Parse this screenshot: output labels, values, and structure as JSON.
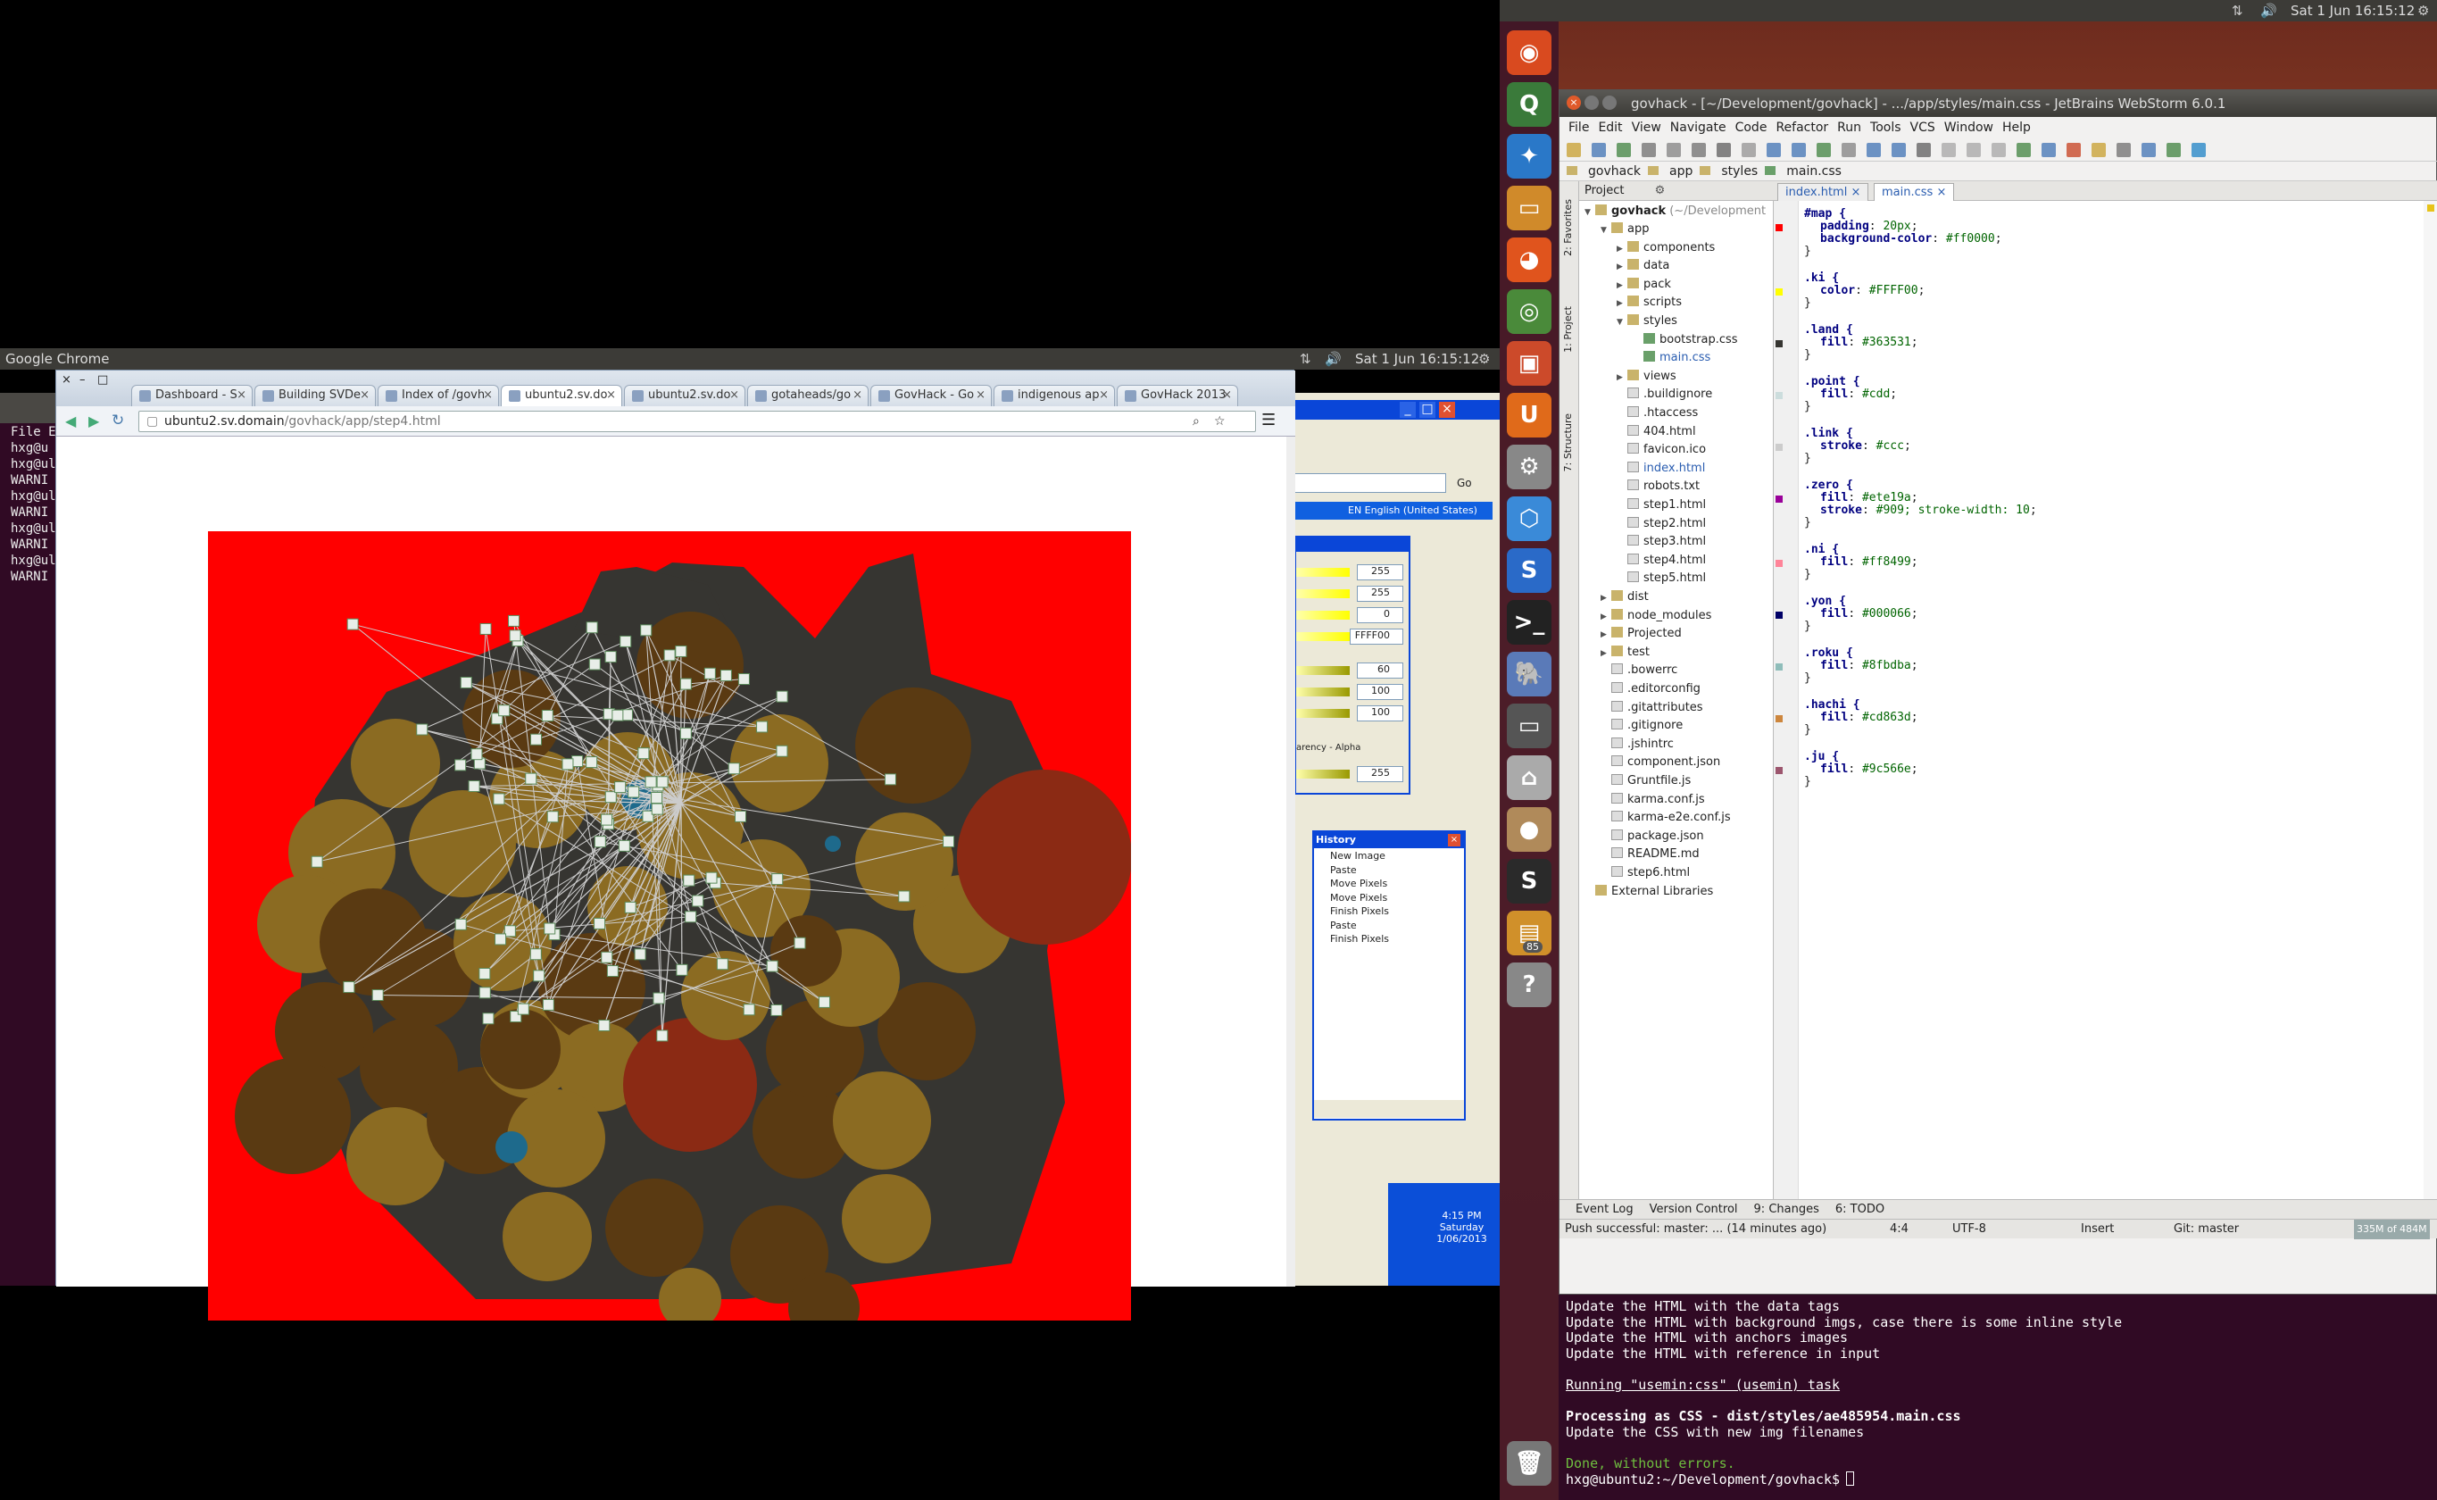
{
  "left_panel": {
    "app_name": "Google Chrome",
    "clock": "Sat  1 Jun  16:15:12",
    "terminal_lines": [
      "File  Ed",
      "hxg@u",
      "hxg@ul",
      "WARNI",
      "hxg@ul",
      "WARNI",
      "hxg@ul",
      "WARNI",
      "hxg@ul",
      "WARNI"
    ]
  },
  "chrome": {
    "tabs": [
      "Dashboard - S",
      "Building SVDe",
      "Index of /govh",
      "ubuntu2.sv.do",
      "ubuntu2.sv.do",
      "gotaheads/go",
      "GovHack - Go",
      "indigenous ap",
      "GovHack 2013"
    ],
    "active_tab": 3,
    "url_host": "ubuntu2.sv.domain",
    "url_path": "/govhack/app/step4.html"
  },
  "xp": {
    "go_label": "Go",
    "lang_label": "EN English (United States)",
    "color_values": [
      "255",
      "255",
      "0",
      "FFFF00",
      "60",
      "100",
      "100",
      "255"
    ],
    "transparency_label": "arency - Alpha",
    "history_title": "History",
    "history_items": [
      "New Image",
      "Paste",
      "Move Pixels",
      "Move Pixels",
      "Finish Pixels",
      "Paste",
      "Finish Pixels"
    ],
    "taskbar_time": "4:15 PM",
    "taskbar_day": "Saturday",
    "taskbar_date": "1/06/2013"
  },
  "right_panel": {
    "clock": "Sat  1 Jun  16:15:12",
    "ws_title": "govhack - [~/Development/govhack] - .../app/styles/main.css - JetBrains WebStorm 6.0.1",
    "menu": [
      "File",
      "Edit",
      "View",
      "Navigate",
      "Code",
      "Refactor",
      "Run",
      "Tools",
      "VCS",
      "Window",
      "Help"
    ],
    "breadcrumb": [
      "govhack",
      "app",
      "styles",
      "main.css"
    ],
    "project_label": "Project",
    "project_root": "govhack",
    "project_root_path": "(~/Development",
    "editor_tabs": [
      "index.html",
      "main.css"
    ],
    "side_labels": [
      "2: Favorites",
      "1: Project",
      "7: Structure"
    ],
    "bottom_tabs": [
      "Event Log",
      "Version Control",
      "9: Changes",
      "6: TODO"
    ],
    "status": {
      "message": "Push successful: master: ... (14 minutes ago)",
      "position": "4:4",
      "encoding": "UTF-8",
      "insert": "Insert",
      "git": "Git: master",
      "memory": "335M of 484M"
    },
    "launcher_badge": "85"
  },
  "tree": [
    {
      "d": 1,
      "t": "folder",
      "n": "app",
      "open": true
    },
    {
      "d": 2,
      "t": "folder",
      "n": "components"
    },
    {
      "d": 2,
      "t": "folder",
      "n": "data"
    },
    {
      "d": 2,
      "t": "folder",
      "n": "pack"
    },
    {
      "d": 2,
      "t": "folder",
      "n": "scripts"
    },
    {
      "d": 2,
      "t": "folder",
      "n": "styles",
      "open": true
    },
    {
      "d": 3,
      "t": "css",
      "n": "bootstrap.css"
    },
    {
      "d": 3,
      "t": "css",
      "n": "main.css",
      "sel": true
    },
    {
      "d": 2,
      "t": "folder",
      "n": "views"
    },
    {
      "d": 2,
      "t": "file",
      "n": ".buildignore"
    },
    {
      "d": 2,
      "t": "file",
      "n": ".htaccess"
    },
    {
      "d": 2,
      "t": "file",
      "n": "404.html"
    },
    {
      "d": 2,
      "t": "file",
      "n": "favicon.ico"
    },
    {
      "d": 2,
      "t": "file",
      "n": "index.html",
      "blue": true
    },
    {
      "d": 2,
      "t": "file",
      "n": "robots.txt"
    },
    {
      "d": 2,
      "t": "file",
      "n": "step1.html"
    },
    {
      "d": 2,
      "t": "file",
      "n": "step2.html"
    },
    {
      "d": 2,
      "t": "file",
      "n": "step3.html"
    },
    {
      "d": 2,
      "t": "file",
      "n": "step4.html"
    },
    {
      "d": 2,
      "t": "file",
      "n": "step5.html"
    },
    {
      "d": 1,
      "t": "folder",
      "n": "dist"
    },
    {
      "d": 1,
      "t": "folder",
      "n": "node_modules"
    },
    {
      "d": 1,
      "t": "folder",
      "n": "Projected"
    },
    {
      "d": 1,
      "t": "folder",
      "n": "test"
    },
    {
      "d": 1,
      "t": "file",
      "n": ".bowerrc"
    },
    {
      "d": 1,
      "t": "file",
      "n": ".editorconfig"
    },
    {
      "d": 1,
      "t": "file",
      "n": ".gitattributes"
    },
    {
      "d": 1,
      "t": "file",
      "n": ".gitignore"
    },
    {
      "d": 1,
      "t": "file",
      "n": ".jshintrc"
    },
    {
      "d": 1,
      "t": "file",
      "n": "component.json"
    },
    {
      "d": 1,
      "t": "file",
      "n": "Gruntfile.js"
    },
    {
      "d": 1,
      "t": "file",
      "n": "karma.conf.js"
    },
    {
      "d": 1,
      "t": "file",
      "n": "karma-e2e.conf.js"
    },
    {
      "d": 1,
      "t": "file",
      "n": "package.json"
    },
    {
      "d": 1,
      "t": "file",
      "n": "README.md"
    },
    {
      "d": 1,
      "t": "file",
      "n": "step6.html"
    },
    {
      "d": 0,
      "t": "lib",
      "n": "External Libraries"
    }
  ],
  "code": [
    {
      "sel": "#map {",
      "props": [
        [
          "padding",
          "20px"
        ],
        [
          "background-color",
          "#ff0000"
        ]
      ],
      "mark": "#ff0000"
    },
    {
      "sel": ".ki {",
      "props": [
        [
          "color",
          "#FFFF00"
        ]
      ],
      "mark": "#FFFF00"
    },
    {
      "sel": ".land {",
      "props": [
        [
          "fill",
          "#363531"
        ]
      ],
      "mark": "#363531"
    },
    {
      "sel": ".point {",
      "props": [
        [
          "fill",
          "#cdd"
        ]
      ],
      "mark": "#ccdddd"
    },
    {
      "sel": ".link {",
      "props": [
        [
          "stroke",
          "#ccc"
        ]
      ],
      "mark": "#cccccc"
    },
    {
      "sel": ".zero {",
      "props": [
        [
          "fill",
          "#ete19a"
        ],
        [
          "stroke",
          "#909; stroke-width: 10"
        ]
      ],
      "mark": "#990099"
    },
    {
      "sel": ".ni {",
      "props": [
        [
          "fill",
          "#ff8499"
        ]
      ],
      "mark": "#ff8499"
    },
    {
      "sel": ".yon {",
      "props": [
        [
          "fill",
          "#000066"
        ]
      ],
      "mark": "#000066"
    },
    {
      "sel": ".roku {",
      "props": [
        [
          "fill",
          "#8fbdba"
        ]
      ],
      "mark": "#8fbdba"
    },
    {
      "sel": ".hachi {",
      "props": [
        [
          "fill",
          "#cd863d"
        ]
      ],
      "mark": "#cd863d"
    },
    {
      "sel": ".ju {",
      "props": [
        [
          "fill",
          "#9c566e"
        ]
      ],
      "mark": "#9c566e"
    }
  ],
  "terminal": [
    {
      "t": "Update the HTML with the data tags"
    },
    {
      "t": "Update the HTML with background imgs, case there is some inline style"
    },
    {
      "t": "Update the HTML with anchors images"
    },
    {
      "t": "Update the HTML with reference in input"
    },
    {
      "t": ""
    },
    {
      "t": "Running \"usemin:css\" (usemin) task",
      "u": true
    },
    {
      "t": ""
    },
    {
      "t": "Processing as CSS - dist/styles/ae485954.main.css",
      "b": true
    },
    {
      "t": "Update the CSS with new img filenames"
    },
    {
      "t": ""
    },
    {
      "t": "Done, without errors.",
      "g": true
    },
    {
      "t": "hxg@ubuntu2:~/Development/govhack$ ",
      "p": true
    }
  ],
  "map_colors": {
    "red": "#ff0000",
    "land": "#363531",
    "gold": "#8b6b22",
    "brown": "#5a3a12",
    "darkred": "#8b2a14",
    "teal": "#1e6a8c"
  }
}
